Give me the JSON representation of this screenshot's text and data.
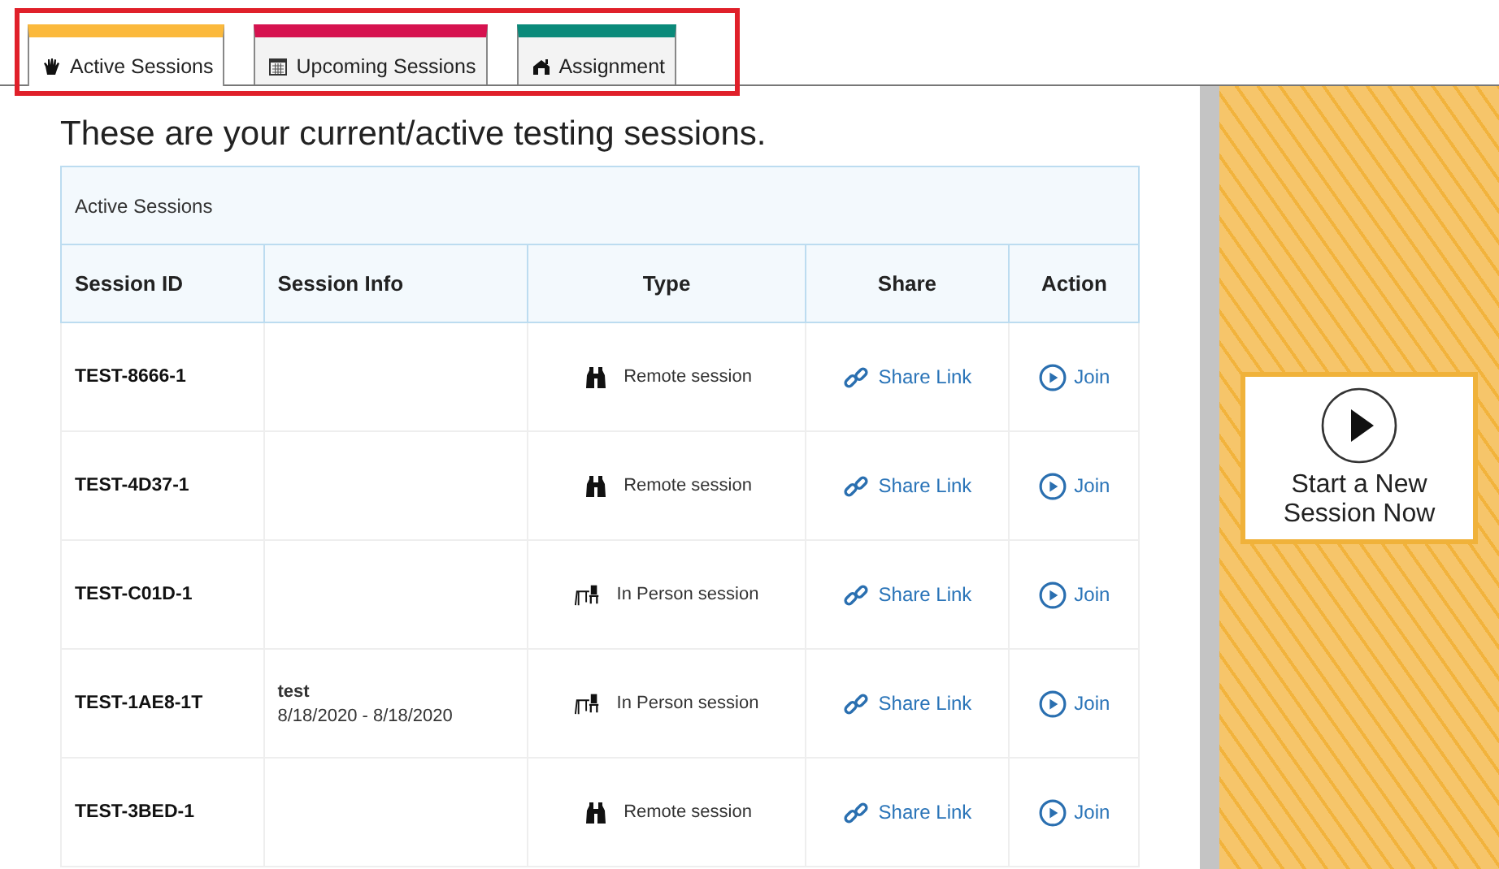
{
  "tabs": [
    {
      "label": "Active Sessions",
      "kind": "hand",
      "color": "#fbb93c",
      "selected": true
    },
    {
      "label": "Upcoming Sessions",
      "kind": "calendar",
      "color": "#d6124f",
      "selected": false
    },
    {
      "label": "Assignment",
      "kind": "house",
      "color": "#0a8a7a",
      "selected": false
    }
  ],
  "heading": "These are your current/active testing sessions.",
  "table": {
    "title": "Active Sessions",
    "columns": [
      "Session ID",
      "Session Info",
      "Type",
      "Share",
      "Action"
    ],
    "rows": [
      {
        "session_id": "TEST-8666-1",
        "type": {
          "kind": "remote",
          "label": "Remote session"
        },
        "share": "Share Link",
        "action": "Join"
      },
      {
        "session_id": "TEST-4D37-1",
        "type": {
          "kind": "remote",
          "label": "Remote session"
        },
        "share": "Share Link",
        "action": "Join"
      },
      {
        "session_id": "TEST-C01D-1",
        "type": {
          "kind": "in_person",
          "label": "In Person session"
        },
        "share": "Share Link",
        "action": "Join"
      },
      {
        "session_id": "TEST-1AE8-1T",
        "info": {
          "name": "test",
          "dates": "8/18/2020 - 8/18/2020"
        },
        "type": {
          "kind": "in_person",
          "label": "In Person session"
        },
        "share": "Share Link",
        "action": "Join"
      },
      {
        "session_id": "TEST-3BED-1",
        "type": {
          "kind": "remote",
          "label": "Remote session"
        },
        "share": "Share Link",
        "action": "Join"
      }
    ]
  },
  "start_button": {
    "label": "Start a New Session Now"
  }
}
